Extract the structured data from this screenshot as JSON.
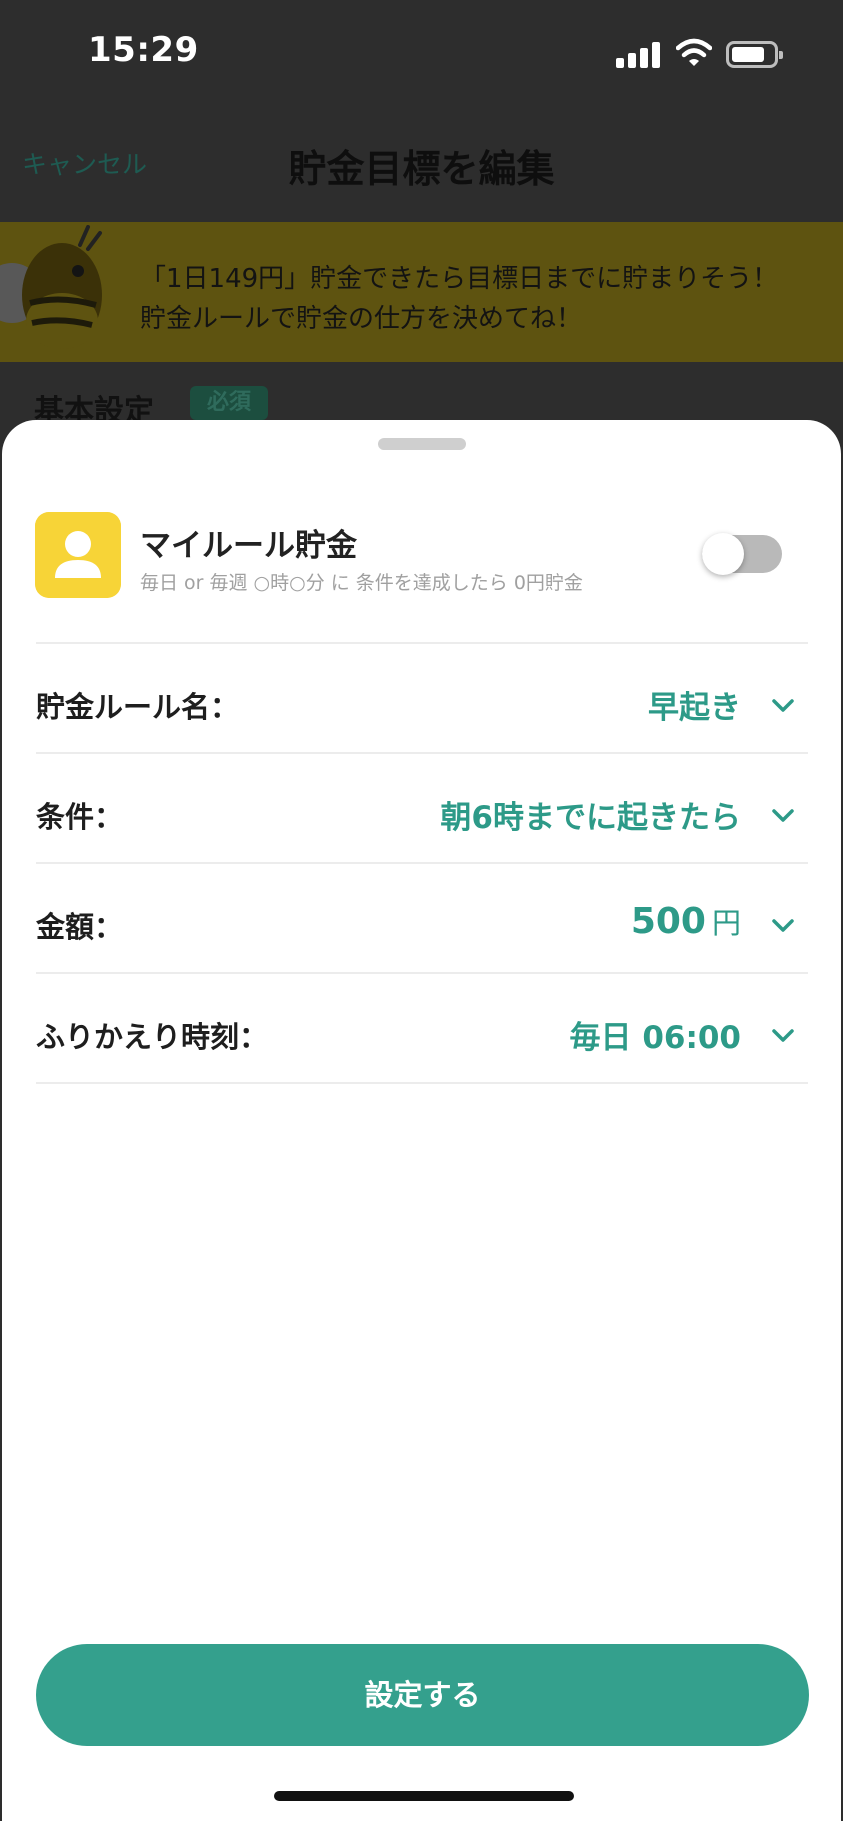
{
  "status_bar": {
    "time": "15:29"
  },
  "nav": {
    "cancel_label": "キャンセル",
    "title": "貯金目標を編集"
  },
  "banner": {
    "line1": "「1日149円」貯金できたら目標日までに貯まりそう！",
    "line2": "貯金ルールで貯金の仕方を決めてね！"
  },
  "basic_settings": {
    "title": "基本設定",
    "required_badge": "必須"
  },
  "sheet": {
    "rule_title": "マイルール貯金",
    "rule_description": "毎日 or 毎週 ○時○分 に 条件を達成したら 0円貯金",
    "toggle_on": false,
    "rows": [
      {
        "label": "貯金ルール名：",
        "value": "早起き",
        "unit": ""
      },
      {
        "label": "条件：",
        "value": "朝6時までに起きたら",
        "unit": ""
      },
      {
        "label": "金額：",
        "value": "500",
        "unit": "円"
      },
      {
        "label": "ふりかえり時刻：",
        "value": "毎日 06:00",
        "unit": ""
      }
    ],
    "confirm_label": "設定する"
  },
  "colors": {
    "accent": "#2d9a88",
    "button": "#34a08d",
    "banner": "#f5d52f",
    "rule_icon_bg": "#f7d437"
  }
}
